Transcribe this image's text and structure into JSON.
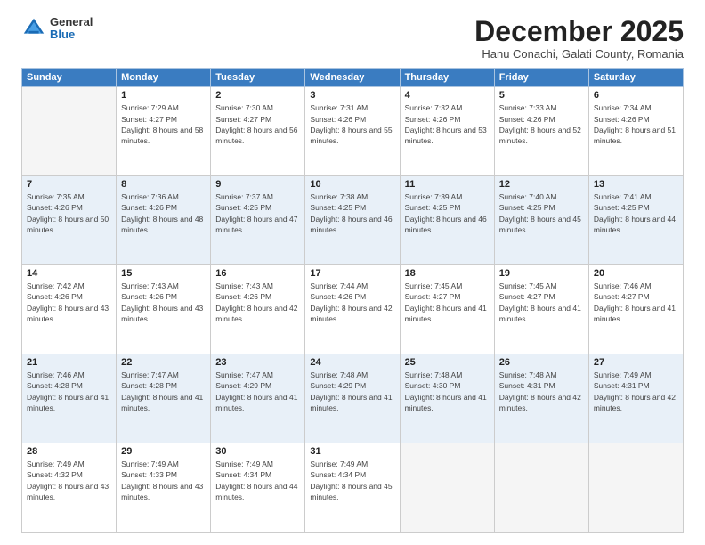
{
  "logo": {
    "general": "General",
    "blue": "Blue"
  },
  "title": "December 2025",
  "subtitle": "Hanu Conachi, Galati County, Romania",
  "weekdays": [
    "Sunday",
    "Monday",
    "Tuesday",
    "Wednesday",
    "Thursday",
    "Friday",
    "Saturday"
  ],
  "weeks": [
    [
      {
        "day": "",
        "empty": true
      },
      {
        "day": "1",
        "sunrise": "7:29 AM",
        "sunset": "4:27 PM",
        "daylight": "8 hours and 58 minutes."
      },
      {
        "day": "2",
        "sunrise": "7:30 AM",
        "sunset": "4:27 PM",
        "daylight": "8 hours and 56 minutes."
      },
      {
        "day": "3",
        "sunrise": "7:31 AM",
        "sunset": "4:26 PM",
        "daylight": "8 hours and 55 minutes."
      },
      {
        "day": "4",
        "sunrise": "7:32 AM",
        "sunset": "4:26 PM",
        "daylight": "8 hours and 53 minutes."
      },
      {
        "day": "5",
        "sunrise": "7:33 AM",
        "sunset": "4:26 PM",
        "daylight": "8 hours and 52 minutes."
      },
      {
        "day": "6",
        "sunrise": "7:34 AM",
        "sunset": "4:26 PM",
        "daylight": "8 hours and 51 minutes."
      }
    ],
    [
      {
        "day": "7",
        "sunrise": "7:35 AM",
        "sunset": "4:26 PM",
        "daylight": "8 hours and 50 minutes."
      },
      {
        "day": "8",
        "sunrise": "7:36 AM",
        "sunset": "4:26 PM",
        "daylight": "8 hours and 48 minutes."
      },
      {
        "day": "9",
        "sunrise": "7:37 AM",
        "sunset": "4:25 PM",
        "daylight": "8 hours and 47 minutes."
      },
      {
        "day": "10",
        "sunrise": "7:38 AM",
        "sunset": "4:25 PM",
        "daylight": "8 hours and 46 minutes."
      },
      {
        "day": "11",
        "sunrise": "7:39 AM",
        "sunset": "4:25 PM",
        "daylight": "8 hours and 46 minutes."
      },
      {
        "day": "12",
        "sunrise": "7:40 AM",
        "sunset": "4:25 PM",
        "daylight": "8 hours and 45 minutes."
      },
      {
        "day": "13",
        "sunrise": "7:41 AM",
        "sunset": "4:25 PM",
        "daylight": "8 hours and 44 minutes."
      }
    ],
    [
      {
        "day": "14",
        "sunrise": "7:42 AM",
        "sunset": "4:26 PM",
        "daylight": "8 hours and 43 minutes."
      },
      {
        "day": "15",
        "sunrise": "7:43 AM",
        "sunset": "4:26 PM",
        "daylight": "8 hours and 43 minutes."
      },
      {
        "day": "16",
        "sunrise": "7:43 AM",
        "sunset": "4:26 PM",
        "daylight": "8 hours and 42 minutes."
      },
      {
        "day": "17",
        "sunrise": "7:44 AM",
        "sunset": "4:26 PM",
        "daylight": "8 hours and 42 minutes."
      },
      {
        "day": "18",
        "sunrise": "7:45 AM",
        "sunset": "4:27 PM",
        "daylight": "8 hours and 41 minutes."
      },
      {
        "day": "19",
        "sunrise": "7:45 AM",
        "sunset": "4:27 PM",
        "daylight": "8 hours and 41 minutes."
      },
      {
        "day": "20",
        "sunrise": "7:46 AM",
        "sunset": "4:27 PM",
        "daylight": "8 hours and 41 minutes."
      }
    ],
    [
      {
        "day": "21",
        "sunrise": "7:46 AM",
        "sunset": "4:28 PM",
        "daylight": "8 hours and 41 minutes."
      },
      {
        "day": "22",
        "sunrise": "7:47 AM",
        "sunset": "4:28 PM",
        "daylight": "8 hours and 41 minutes."
      },
      {
        "day": "23",
        "sunrise": "7:47 AM",
        "sunset": "4:29 PM",
        "daylight": "8 hours and 41 minutes."
      },
      {
        "day": "24",
        "sunrise": "7:48 AM",
        "sunset": "4:29 PM",
        "daylight": "8 hours and 41 minutes."
      },
      {
        "day": "25",
        "sunrise": "7:48 AM",
        "sunset": "4:30 PM",
        "daylight": "8 hours and 41 minutes."
      },
      {
        "day": "26",
        "sunrise": "7:48 AM",
        "sunset": "4:31 PM",
        "daylight": "8 hours and 42 minutes."
      },
      {
        "day": "27",
        "sunrise": "7:49 AM",
        "sunset": "4:31 PM",
        "daylight": "8 hours and 42 minutes."
      }
    ],
    [
      {
        "day": "28",
        "sunrise": "7:49 AM",
        "sunset": "4:32 PM",
        "daylight": "8 hours and 43 minutes."
      },
      {
        "day": "29",
        "sunrise": "7:49 AM",
        "sunset": "4:33 PM",
        "daylight": "8 hours and 43 minutes."
      },
      {
        "day": "30",
        "sunrise": "7:49 AM",
        "sunset": "4:34 PM",
        "daylight": "8 hours and 44 minutes."
      },
      {
        "day": "31",
        "sunrise": "7:49 AM",
        "sunset": "4:34 PM",
        "daylight": "8 hours and 45 minutes."
      },
      {
        "day": "",
        "empty": true
      },
      {
        "day": "",
        "empty": true
      },
      {
        "day": "",
        "empty": true
      }
    ]
  ]
}
